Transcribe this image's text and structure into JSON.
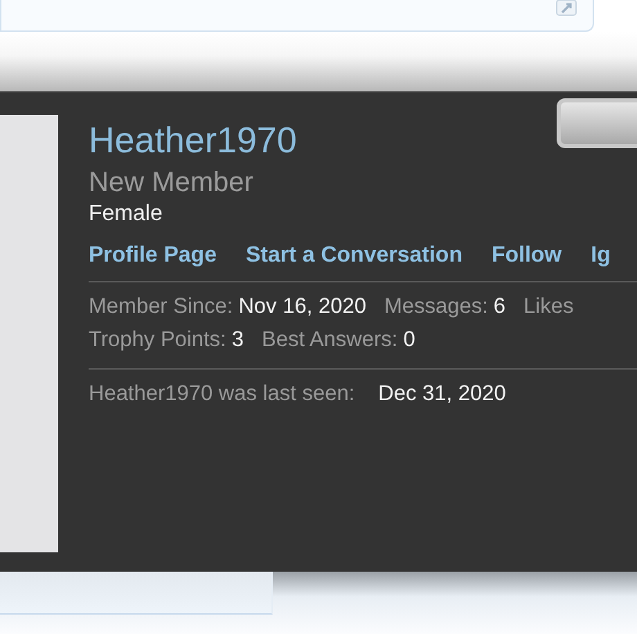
{
  "profile_card": {
    "username": "Heather1970",
    "user_title": "New Member",
    "gender": "Female",
    "links": [
      "Profile Page",
      "Start a Conversation",
      "Follow",
      "Ig"
    ],
    "stats_rows": [
      [
        {
          "label": "Member Since:",
          "value": "Nov 16, 2020"
        },
        {
          "label": "Messages:",
          "value": "6"
        },
        {
          "label": "Likes"
        }
      ],
      [
        {
          "label": "Trophy Points:",
          "value": "3"
        },
        {
          "label": "Best Answers:",
          "value": "0"
        }
      ]
    ],
    "last_seen": {
      "label": "Heather1970 was last seen:",
      "value": "Dec 31, 2020"
    }
  }
}
